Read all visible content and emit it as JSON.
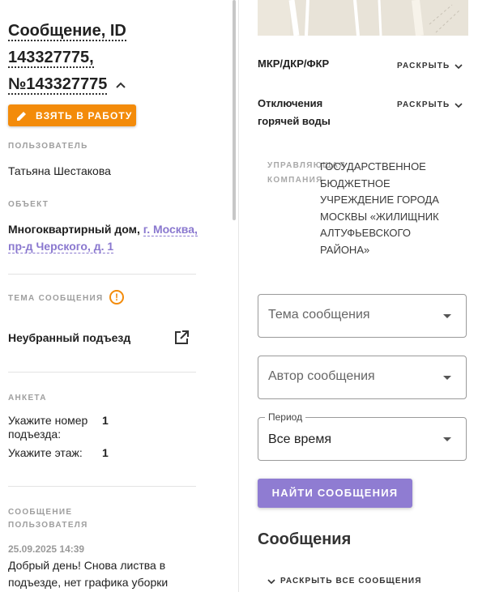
{
  "message": {
    "title_line1": "Сообщение, ID",
    "title_line2": "143327775,",
    "title_line3": "№143327775",
    "take_button": "ВЗЯТЬ В РАБОТУ",
    "user_label": "ПОЛЬЗОВАТЕЛЬ",
    "user_name": "Татьяна Шестакова",
    "object_label": "ОБЪЕКТ",
    "object_type": "Многоквартирный дом,",
    "object_address_1": "г. Москва,",
    "object_address_2": "пр-д Черского, д. 1",
    "topic_label": "ТЕМА СООБЩЕНИЯ",
    "topic_value": "Неубранный подъезд",
    "survey_label": "АНКЕТА",
    "survey": [
      {
        "q1": "Укажите номер",
        "q2": "подъезда:",
        "a": "1"
      },
      {
        "q1": "Укажите этаж:",
        "q2": "",
        "a": "1"
      }
    ],
    "user_msg_label_1": "СООБЩЕНИЕ",
    "user_msg_label_2": "ПОЛЬЗОВАТЕЛЯ",
    "user_msg_time": "25.09.2025 14:39",
    "user_msg_line1": "Добрый день! Снова листва в",
    "user_msg_line2": "подъезде, нет графика уборки"
  },
  "right": {
    "mkr_label": "МКР/ДКР/ФКР",
    "expand_label": "РАСКРЫТЬ",
    "hotwater_line1": "Отключения",
    "hotwater_line2": "горячей воды",
    "org_label_1": "УПРАВЛЯЮЩАЯ",
    "org_label_2": "КОМПАНИЯ",
    "org_value": "ГОСУДАРСТВЕННОЕ БЮДЖЕТНОЕ УЧРЕЖДЕНИЕ ГОРОДА МОСКВЫ «ЖИЛИЩНИК АЛТУФЬЕВСКОГО РАЙОНА»",
    "topic_placeholder": "Тема сообщения",
    "author_placeholder": "Автор сообщения",
    "period_label": "Период",
    "period_value": "Все время",
    "find_button": "НАЙТИ СООБЩЕНИЯ",
    "messages_heading": "Сообщения",
    "expand_all": "РАСКРЫТЬ ВСЕ СООБЩЕНИЯ"
  },
  "colors": {
    "accent_orange": "#f38b0a",
    "accent_purple": "#8f7cd2",
    "link": "#8a78cf"
  }
}
